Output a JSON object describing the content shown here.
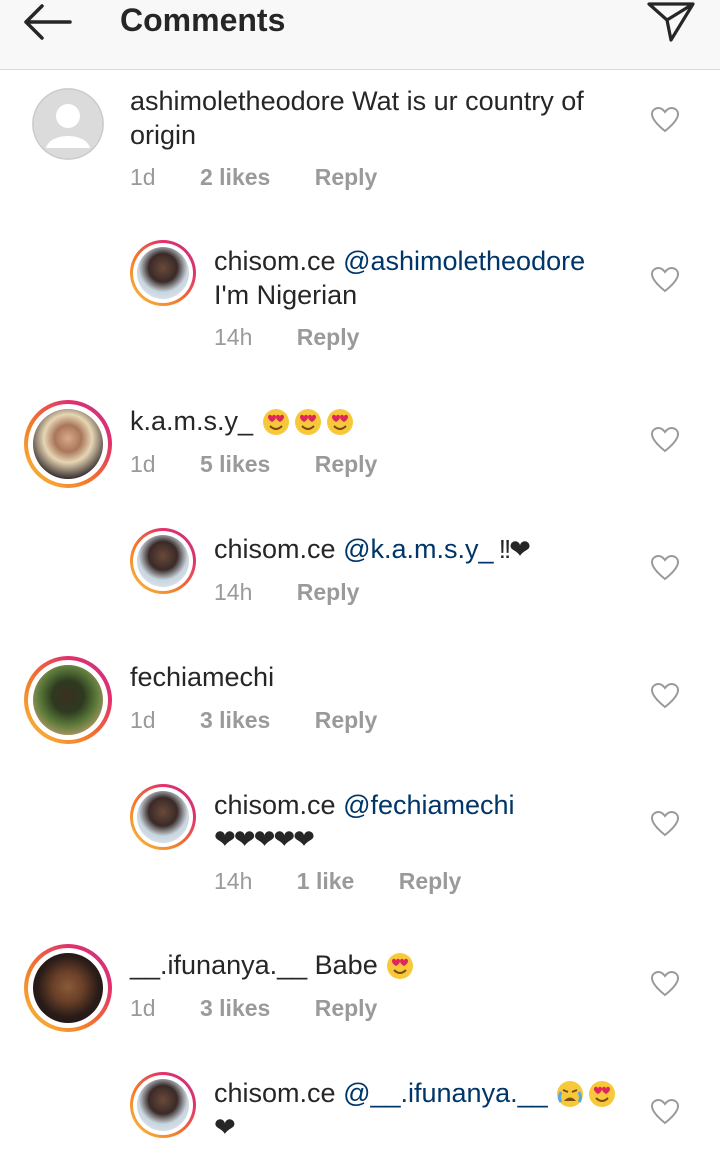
{
  "header": {
    "title": "Comments",
    "back_icon": "arrow-left-icon",
    "send_icon": "paper-plane-icon"
  },
  "colors": {
    "mention": "#003569",
    "meta": "#8e8e8e",
    "text": "#262626"
  },
  "comments": [
    {
      "username": "ashimoletheodore",
      "text_line1": " Wat is ur country of",
      "text_line2": "origin",
      "time": "1d",
      "likes": "2 likes",
      "reply": "Reply"
    },
    {
      "username": "chisom.ce",
      "mention": "@ashimoletheodore",
      "text_line2": "I'm Nigerian",
      "time": "14h",
      "reply": "Reply"
    },
    {
      "username": "k.a.m.s.y_",
      "emoji": "smiling-face-with-heart-eyes x3",
      "time": "1d",
      "likes": "5 likes",
      "reply": "Reply"
    },
    {
      "username": "chisom.ce",
      "mention": "@k.a.m.s.y_",
      "tail": " !!❤",
      "time": "14h",
      "reply": "Reply"
    },
    {
      "username": "fechiamechi",
      "time": "1d",
      "likes": "3 likes",
      "reply": "Reply"
    },
    {
      "username": "chisom.ce",
      "mention": "@fechiamechi",
      "text_line2": "❤❤❤❤❤",
      "time": "14h",
      "likes": "1 like",
      "reply": "Reply"
    },
    {
      "username": "__.ifunanya.__",
      "text_line1": " Babe",
      "emoji": "smiling-face-with-heart-eyes",
      "time": "1d",
      "likes": "3 likes",
      "reply": "Reply"
    },
    {
      "username": "chisom.ce",
      "mention": "@__.ifunanya.__",
      "emoji": "crying-face, smiling-face-with-heart-eyes",
      "text_line2": "❤"
    }
  ]
}
